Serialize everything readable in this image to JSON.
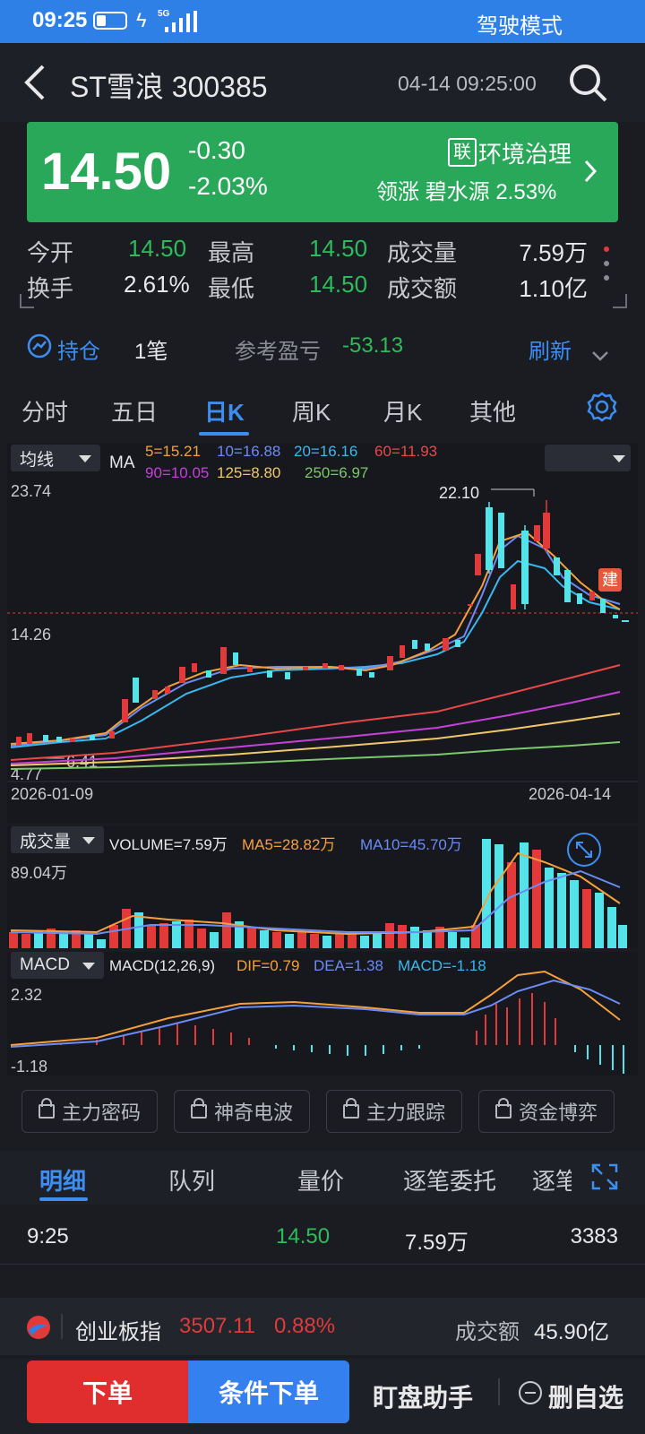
{
  "status": {
    "time": "09:25",
    "network": "5G",
    "drive_mode": "驾驶模式"
  },
  "header": {
    "title": "ST雪浪 300385",
    "datetime": "04-14 09:25:00"
  },
  "price": {
    "current": "14.50",
    "change": "-0.30",
    "change_pct": "-2.03%",
    "badge": "联",
    "sector": "环境治理",
    "leader_label": "领涨 碧水源 2.53%"
  },
  "stats": {
    "open_label": "今开",
    "open": "14.50",
    "high_label": "最高",
    "high": "14.50",
    "vol_label": "成交量",
    "vol": "7.59万",
    "turnover_label": "换手",
    "turnover": "2.61%",
    "low_label": "最低",
    "low": "14.50",
    "amount_label": "成交额",
    "amount": "1.10亿"
  },
  "position": {
    "label": "持仓",
    "count": "1笔",
    "pl_label": "参考盈亏",
    "pl": "-53.13",
    "refresh": "刷新"
  },
  "tabs": [
    "分时",
    "五日",
    "日K",
    "周K",
    "月K",
    "其他"
  ],
  "kchart": {
    "ma_dropdown": "均线",
    "ma_label": "MA",
    "ma5": "5=15.21",
    "ma10": "10=16.88",
    "ma20": "20=16.16",
    "ma60": "60=11.93",
    "ma90": "90=10.05",
    "ma125": "125=8.80",
    "ma250": "250=6.97",
    "y_top": "23.74",
    "y_mid": "14.26",
    "y_bot": "4.77",
    "high_mark": "22.10",
    "low_mark": "6.41",
    "date_start": "2026-01-09",
    "date_end": "2026-04-14",
    "build_tag": "建"
  },
  "volume": {
    "dropdown": "成交量",
    "vol": "VOLUME=7.59万",
    "ma5": "MA5=28.82万",
    "ma10": "MA10=45.70万",
    "y_top": "89.04万"
  },
  "macd": {
    "dropdown": "MACD",
    "params": "MACD(12,26,9)",
    "dif": "DIF=0.79",
    "dea": "DEA=1.38",
    "macd": "MACD=-1.18",
    "y_top": "2.32",
    "y_bot": "-1.18"
  },
  "locks": [
    "主力密码",
    "神奇电波",
    "主力跟踪",
    "资金博弈"
  ],
  "detail_tabs": [
    "明细",
    "队列",
    "量价",
    "逐笔委托",
    "逐笔"
  ],
  "detail_row": {
    "time": "9:25",
    "price": "14.50",
    "vol": "7.59万",
    "count": "3383"
  },
  "index_bar": {
    "name": "创业板指",
    "value": "3507.11",
    "pct": "0.88%",
    "amount_label": "成交额",
    "amount": "45.90亿"
  },
  "bottom": {
    "order": "下单",
    "cond_order": "条件下单",
    "helper": "盯盘助手",
    "remove": "删自选"
  },
  "colors": {
    "accent": "#2f80e6",
    "up": "#e23a3a",
    "down": "#2bbd5a",
    "cyan": "#54e3e8"
  }
}
